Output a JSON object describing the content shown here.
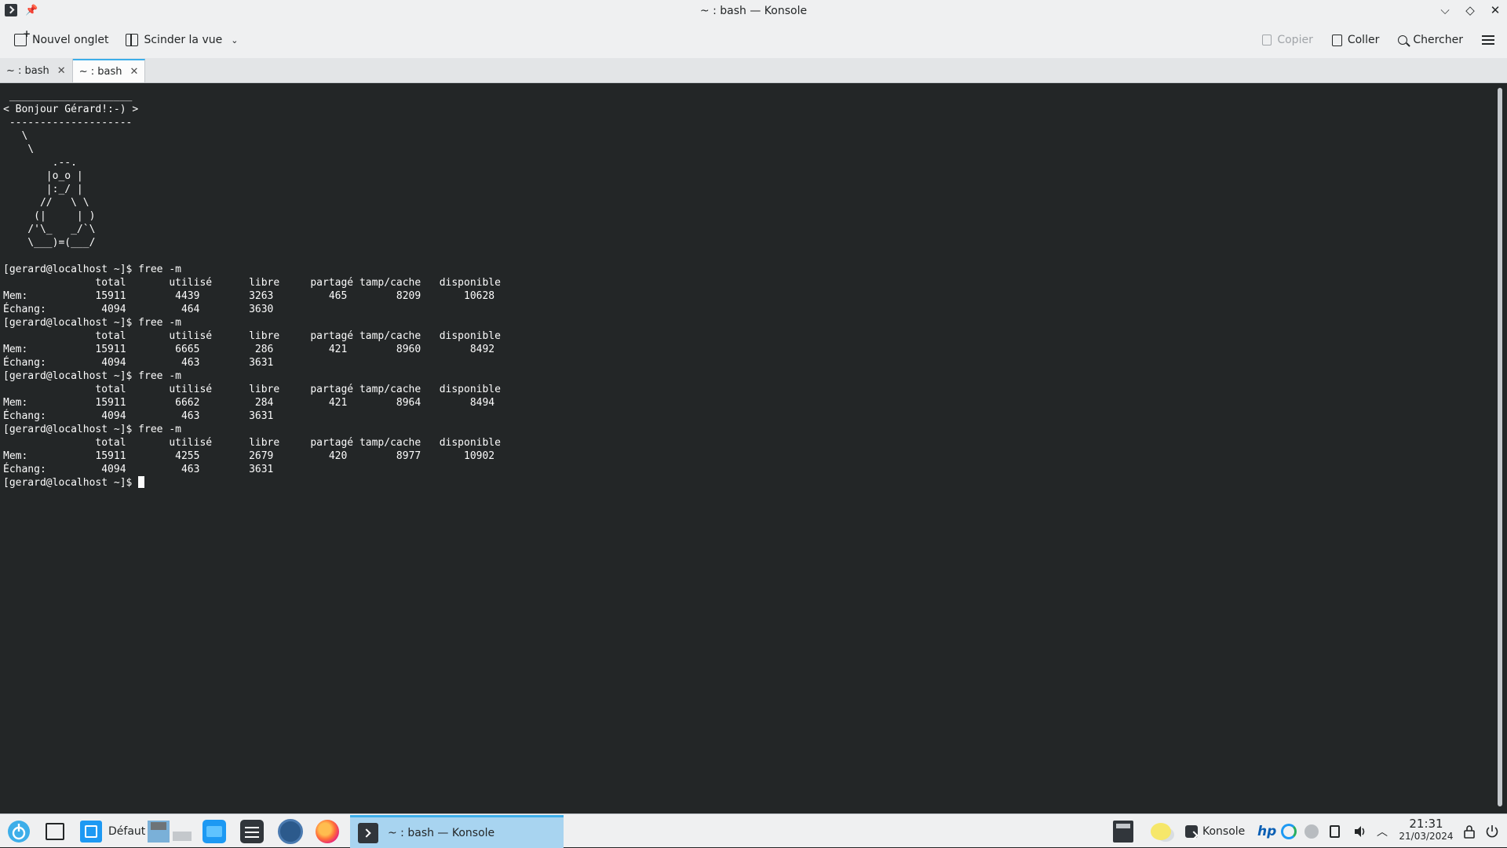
{
  "window": {
    "title": "~ : bash — Konsole",
    "pin_glyph": "📌",
    "controls": {
      "minimize": "⌵",
      "maximize": "◇",
      "close": "✕"
    }
  },
  "toolbar": {
    "new_tab": "Nouvel onglet",
    "split_view": "Scinder la vue",
    "copy": "Copier",
    "paste": "Coller",
    "search": "Chercher"
  },
  "tabs": [
    {
      "label": "~ : bash",
      "close": "✕"
    },
    {
      "label": "~ : bash",
      "close": "✕"
    }
  ],
  "terminal": {
    "lines": [
      " ____________________",
      "< Bonjour Gérard!:-) >",
      " --------------------",
      "   \\",
      "    \\",
      "        .--.",
      "       |o_o |",
      "       |:_/ |",
      "      //   \\ \\",
      "     (|     | )",
      "    /'\\_   _/`\\",
      "    \\___)=(___/",
      "",
      "[gerard@localhost ~]$ free -m",
      "               total       utilisé      libre     partagé tamp/cache   disponible",
      "Mem:           15911        4439        3263         465        8209       10628",
      "Échang:         4094         464        3630",
      "[gerard@localhost ~]$ free -m",
      "               total       utilisé      libre     partagé tamp/cache   disponible",
      "Mem:           15911        6665         286         421        8960        8492",
      "Échang:         4094         463        3631",
      "[gerard@localhost ~]$ free -m",
      "               total       utilisé      libre     partagé tamp/cache   disponible",
      "Mem:           15911        6662         284         421        8964        8494",
      "Échang:         4094         463        3631",
      "[gerard@localhost ~]$ free -m",
      "               total       utilisé      libre     partagé tamp/cache   disponible",
      "Mem:           15911        4255        2679         420        8977       10902",
      "Échang:         4094         463        3631"
    ],
    "prompt": "[gerard@localhost ~]$ "
  },
  "taskbar": {
    "activity_label": "Défaut",
    "active_task": "~ : bash — Konsole",
    "tray_app": "Konsole",
    "hp_label": "hp",
    "time": "21:31",
    "date": "21/03/2024"
  }
}
